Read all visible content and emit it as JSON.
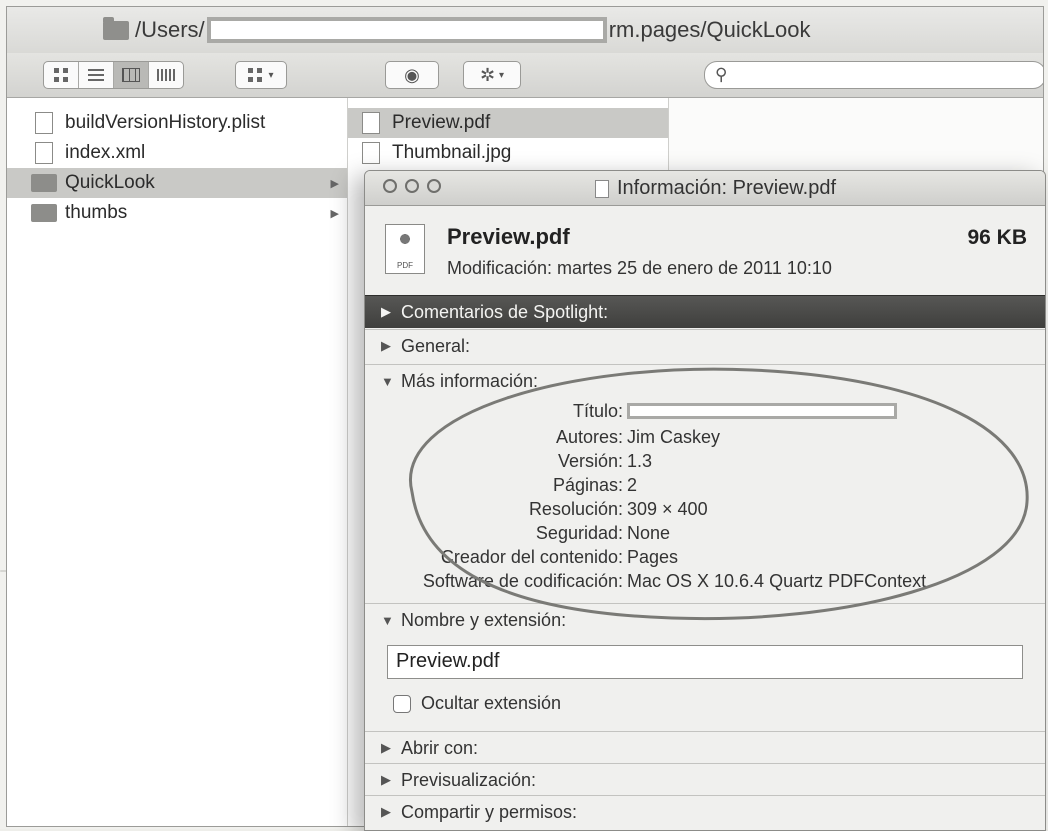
{
  "finder": {
    "path_prefix": "/Users/",
    "path_suffix": "rm.pages/QuickLook",
    "search_placeholder": "",
    "view_buttons": [
      "icon-view-icon",
      "list-view-icon",
      "column-view-icon",
      "cover-flow-view-icon"
    ],
    "arrange_icon": "arrange-icon",
    "quicklook_icon": "eye-icon",
    "action_icon": "gear-icon"
  },
  "column1": {
    "items": [
      {
        "label": "buildVersionHistory.plist",
        "kind": "file",
        "selected": false
      },
      {
        "label": "index.xml",
        "kind": "file",
        "selected": false
      },
      {
        "label": "QuickLook",
        "kind": "folder",
        "selected": true
      },
      {
        "label": "thumbs",
        "kind": "folder",
        "selected": false
      }
    ]
  },
  "column2": {
    "items": [
      {
        "label": "Preview.pdf",
        "kind": "file",
        "selected": true
      },
      {
        "label": "Thumbnail.jpg",
        "kind": "file",
        "selected": false
      }
    ]
  },
  "info": {
    "window_title": "Información: Preview.pdf",
    "file_name": "Preview.pdf",
    "file_size": "96 KB",
    "modified": "Modificación:  martes 25 de enero de 2011 10:10",
    "sections": {
      "spotlight": "Comentarios de Spotlight:",
      "general": "General:",
      "more_info": "Más información:",
      "name_ext": "Nombre y extensión:",
      "open_with": "Abrir con:",
      "preview": "Previsualización:",
      "sharing": "Compartir y permisos:"
    },
    "details": [
      {
        "key": "Título:",
        "value": ""
      },
      {
        "key": "Autores:",
        "value": "Jim Caskey"
      },
      {
        "key": "Versión:",
        "value": "1.3"
      },
      {
        "key": "Páginas:",
        "value": "2"
      },
      {
        "key": "Resolución:",
        "value": "309 × 400"
      },
      {
        "key": "Seguridad:",
        "value": "None"
      },
      {
        "key": "Creador del contenido:",
        "value": "Pages"
      },
      {
        "key": "Software de codificación:",
        "value": "Mac OS X 10.6.4 Quartz PDFContext"
      }
    ],
    "name_value": "Preview.pdf",
    "hide_extension_label": "Ocultar extensión",
    "hide_extension_checked": false
  },
  "colors": {
    "selection": "#c9c9c6",
    "spotlight_header": "#4a4a48",
    "annotation_oval": "#7a7a76"
  }
}
